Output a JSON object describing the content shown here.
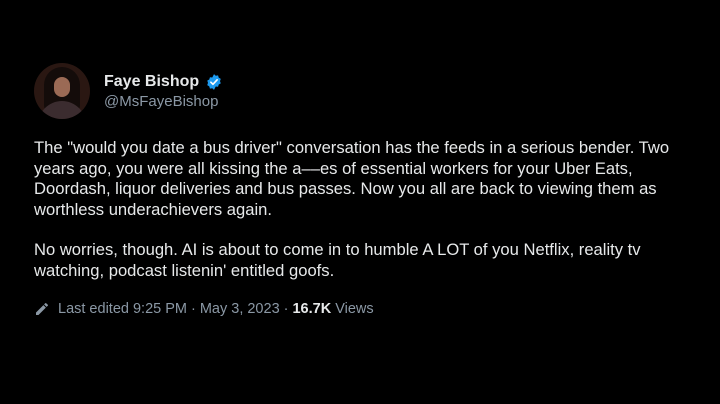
{
  "tweet": {
    "author": {
      "display_name": "Faye Bishop",
      "handle": "@MsFayeBishop",
      "verified": true,
      "avatar": "avatar-photo"
    },
    "paragraphs": [
      "The \"would you date a bus driver\" conversation has the feeds in a serious bender. Two years ago, you were all kissing the a‒‒es of essential workers for your Uber Eats, Doordash, liquor deliveries and bus passes. Now you all are back to viewing them as worthless underachievers again.",
      "No worries, though.  AI is about to come in to humble A LOT of you Netflix, reality tv watching, podcast listenin' entitled goofs."
    ],
    "meta": {
      "edit_icon": "pencil-icon",
      "edited_label": "Last edited 9:25 PM",
      "separator": "·",
      "date": "May 3, 2023",
      "views_count": "16.7K",
      "views_label": "Views"
    }
  },
  "colors": {
    "background": "#000000",
    "primary_text": "#e7e9ea",
    "secondary_text": "#8b98a5",
    "verified_badge": "#1d9bf0"
  }
}
